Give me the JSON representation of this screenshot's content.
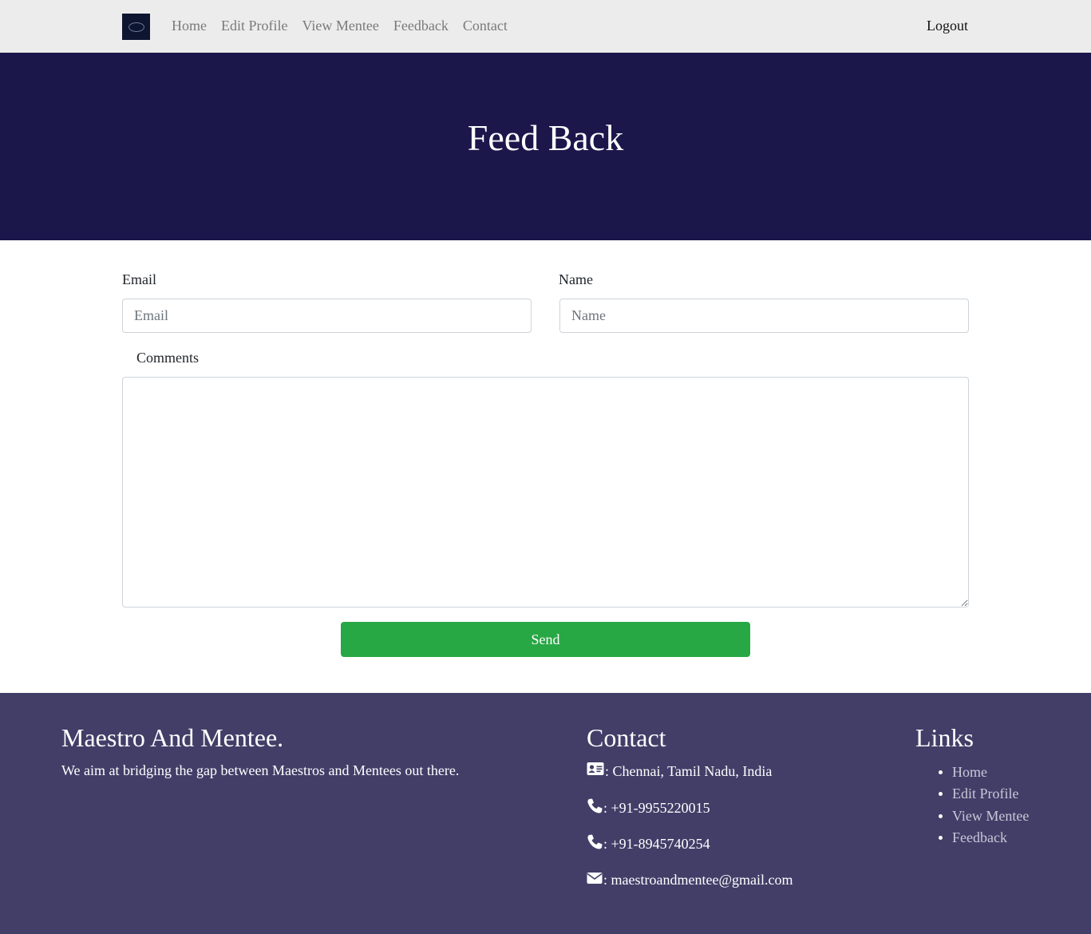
{
  "navbar": {
    "links": [
      "Home",
      "Edit Profile",
      "View Mentee",
      "Feedback",
      "Contact"
    ],
    "logout": "Logout"
  },
  "hero": {
    "title": "Feed Back"
  },
  "form": {
    "email_label": "Email",
    "email_placeholder": "Email",
    "name_label": "Name",
    "name_placeholder": "Name",
    "comments_label": "Comments",
    "send_label": "Send"
  },
  "footer": {
    "about_heading": "Maestro And Mentee.",
    "about_text": "We aim at bridging the gap between Maestros and Mentees out there.",
    "contact_heading": "Contact",
    "contact_items": [
      {
        "icon": "address-card-icon",
        "text": ": Chennai, Tamil Nadu, India"
      },
      {
        "icon": "phone-icon",
        "text": ": +91-9955220015"
      },
      {
        "icon": "phone-icon",
        "text": ": +91-8945740254"
      },
      {
        "icon": "envelope-icon",
        "text": ": maestroandmentee@gmail.com"
      }
    ],
    "links_heading": "Links",
    "links": [
      "Home",
      "Edit Profile",
      "View Mentee",
      "Feedback"
    ]
  },
  "colors": {
    "navbar_bg": "#ececec",
    "hero_bg": "#1b174b",
    "footer_bg": "#423e68",
    "send_button": "#28a745"
  }
}
